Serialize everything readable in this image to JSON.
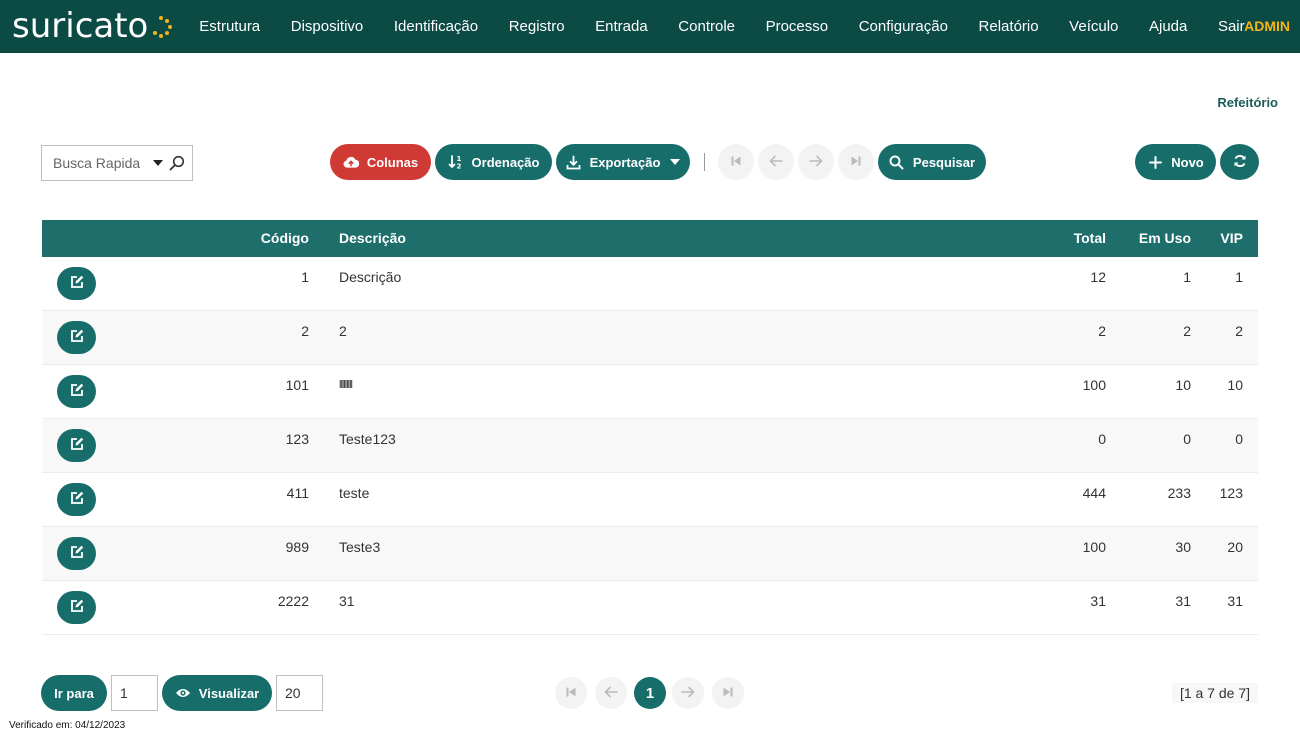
{
  "brand": {
    "logo_text": "suricato",
    "accent": "#f4b41a",
    "nav_bg": "#0c4a44",
    "teal": "#176d6a",
    "red": "#cf3a34"
  },
  "nav": {
    "items": [
      "Estrutura",
      "Dispositivo",
      "Identificação",
      "Registro",
      "Entrada",
      "Controle",
      "Processo",
      "Configuração",
      "Relatório",
      "Veículo",
      "Ajuda",
      "Sair"
    ],
    "user": "ADMIN"
  },
  "page": {
    "title": "Refeitório"
  },
  "toolbar": {
    "quick_search_placeholder": "Busca Rapida",
    "columns_label": "Colunas",
    "order_label": "Ordenação",
    "export_label": "Exportação",
    "search_label": "Pesquisar",
    "new_label": "Novo"
  },
  "table": {
    "headers": {
      "code": "Código",
      "description": "Descrição",
      "total": "Total",
      "in_use": "Em Uso",
      "vip": "VIP"
    },
    "rows": [
      {
        "code": "1",
        "description": "Descrição",
        "total": "12",
        "in_use": "1",
        "vip": "1"
      },
      {
        "code": "2",
        "description": "2",
        "total": "2",
        "in_use": "2",
        "vip": "2"
      },
      {
        "code": "101",
        "description": "lllllllll",
        "total": "100",
        "in_use": "10",
        "vip": "10"
      },
      {
        "code": "123",
        "description": "Teste123",
        "total": "0",
        "in_use": "0",
        "vip": "0"
      },
      {
        "code": "411",
        "description": "teste",
        "total": "444",
        "in_use": "233",
        "vip": "123"
      },
      {
        "code": "989",
        "description": "Teste3",
        "total": "100",
        "in_use": "30",
        "vip": "20"
      },
      {
        "code": "2222",
        "description": "31",
        "total": "31",
        "in_use": "31",
        "vip": "31"
      }
    ]
  },
  "footer": {
    "goto_label": "Ir para",
    "goto_value": "1",
    "view_label": "Visualizar",
    "view_value": "20",
    "current_page": "1",
    "count_info": "[1 a 7 de 7]",
    "verified": "Verificado em: 04/12/2023"
  }
}
